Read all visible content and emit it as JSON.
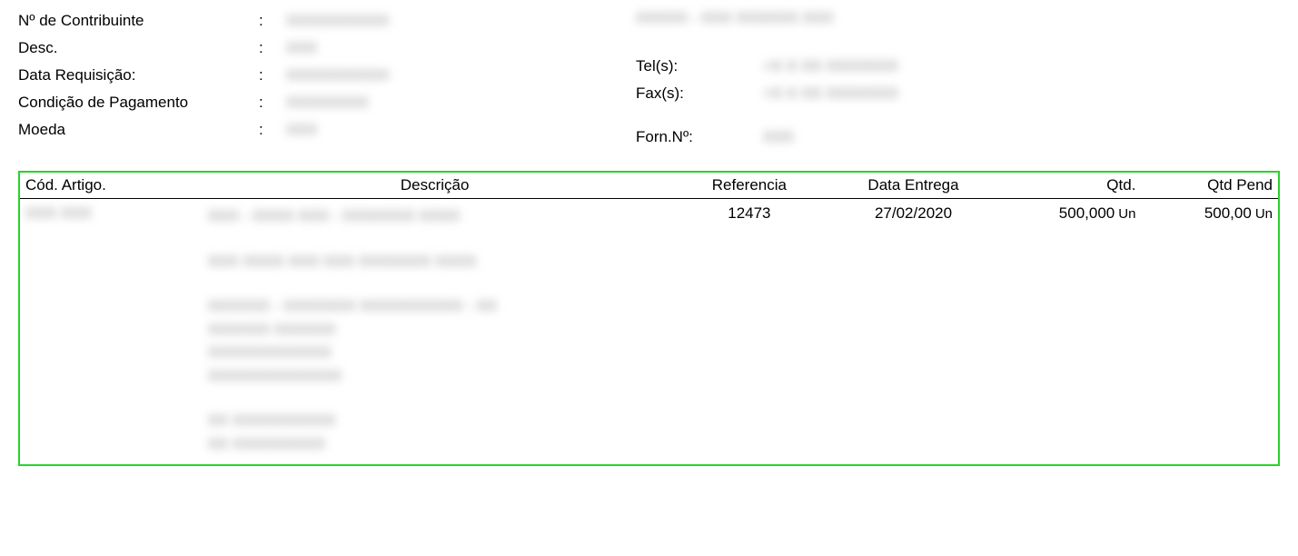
{
  "header": {
    "left": {
      "contribuinte_label": "Nº de Contribuinte",
      "contribuinte_value": "XXXXXXXXXX",
      "desc_label": "Desc.",
      "desc_value": "XXX",
      "data_requisicao_label": "Data Requisição:",
      "data_requisicao_value": "XXXXXXXXXX",
      "condicao_pagamento_label": "Condição de Pagamento",
      "condicao_pagamento_value": "XXXXXXXX",
      "moeda_label": "Moeda",
      "moeda_value": "XXX"
    },
    "right": {
      "top_line": "XXXXX - XXX XXXXXX XXX",
      "tel_label": "Tel(s):",
      "tel_value": "+X X XX XXXXXXX",
      "fax_label": "Fax(s):",
      "fax_value": "+X X XX XXXXXXX",
      "forn_label": "Forn.Nº:",
      "forn_value": "XXX"
    }
  },
  "table": {
    "headers": {
      "cod": "Cód. Artigo.",
      "desc": "Descrição",
      "ref": "Referencia",
      "date": "Data Entrega",
      "qtd": "Qtd.",
      "pend": "Qtd Pend"
    },
    "row": {
      "cod": "XXX XXX",
      "desc_line1": "XXX - XXXX XXX - XXXXXXX XXXX",
      "desc_line2": "XXX XXXX XXX XXX XXXXXXX XXXX",
      "desc_line3": "XXXXXX - XXXXXXX XXXXXXXXXX - XX",
      "desc_line4": "XXXXXX XXXXXX",
      "desc_line5": "XXXXXXXXXXXX",
      "desc_line6": "XXXXXXXXXXXXX",
      "desc_line7": "XX XXXXXXXXXX",
      "desc_line8": "XX XXXXXXXXX",
      "ref": "12473",
      "date": "27/02/2020",
      "qtd": "500,000",
      "qtd_unit": "Un",
      "pend": "500,00",
      "pend_unit": "Un"
    }
  }
}
